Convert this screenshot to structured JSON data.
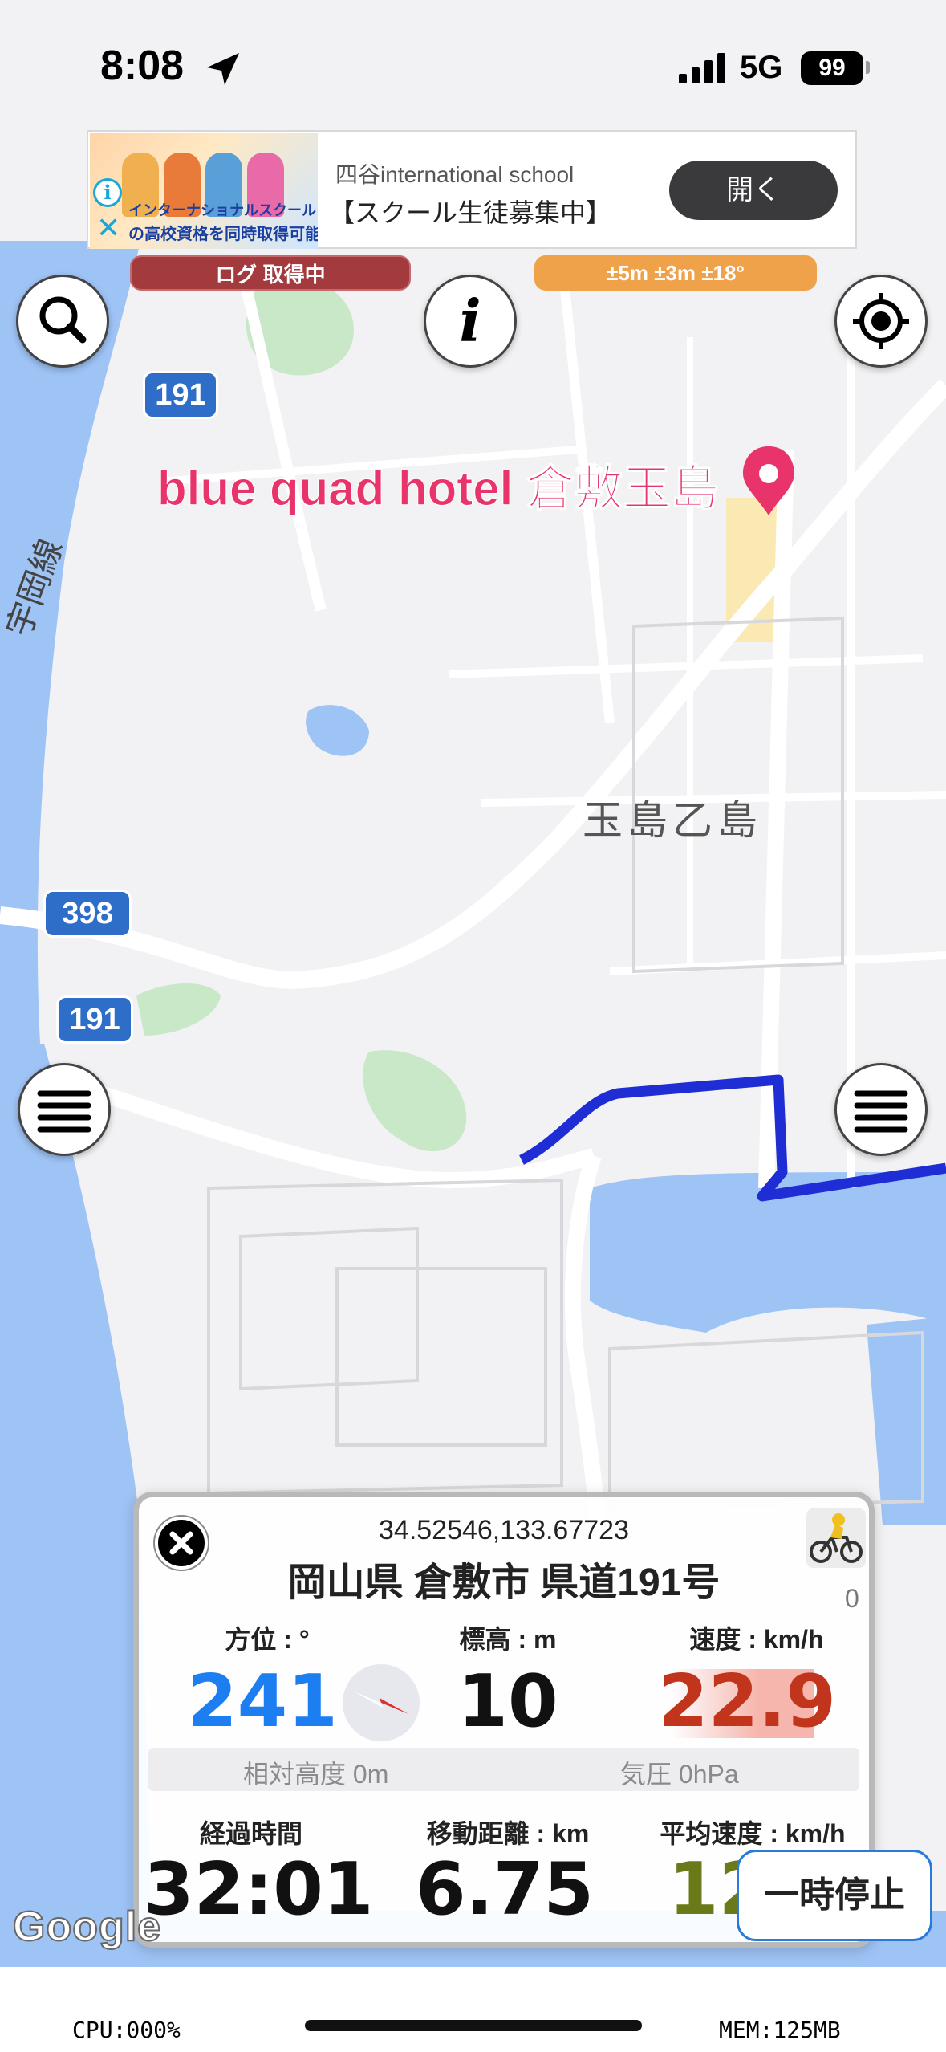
{
  "status_bar": {
    "time": "8:08",
    "network": "5G",
    "battery": "99"
  },
  "ad": {
    "title": "四谷international school",
    "subtitle": "【スクール生徒募集中】",
    "open_label": "開く",
    "image_line1": "インターナショナルスクール",
    "image_line2": "の高校資格を同時取得可能"
  },
  "badges": {
    "log_status": "ログ 取得中",
    "accuracy": "±5m ±3m ±18°"
  },
  "map": {
    "poi_name": "blue quad hotel 倉敷玉島",
    "area_name": "玉島乙島",
    "road_shields": [
      "191",
      "398",
      "191"
    ],
    "rail_label": "宇岡線",
    "attribution": "Google",
    "colors": {
      "route": "#1f2ed4",
      "water": "#9ec3f5",
      "land": "#f2f2f4",
      "park": "#c9e8c8",
      "poi": "#e8336b"
    }
  },
  "panel": {
    "coordinates": "34.52546,133.67723",
    "address": "岡山県 倉敷市 県道191号",
    "activity_count": "0",
    "bearing_label": "方位 : °",
    "bearing_value": "241",
    "elevation_label": "標高 : m",
    "elevation_value": "10",
    "speed_label": "速度 : km/h",
    "speed_value": "22.9",
    "relative_altitude": "相対高度 0m",
    "pressure": "気圧 0hPa",
    "elapsed_label": "経過時間",
    "elapsed_value": "32:01",
    "distance_label": "移動距離 : km",
    "distance_value": "6.75",
    "avg_speed_label": "平均速度 : km/h",
    "avg_speed_value": "12",
    "colors": {
      "bearing": "#1c7ef0",
      "speed": "#c0351c",
      "avg": "#6b7a18"
    }
  },
  "pause_label": "一時停止",
  "footer": {
    "cpu": "CPU:000%",
    "mem": "MEM:125MB"
  }
}
